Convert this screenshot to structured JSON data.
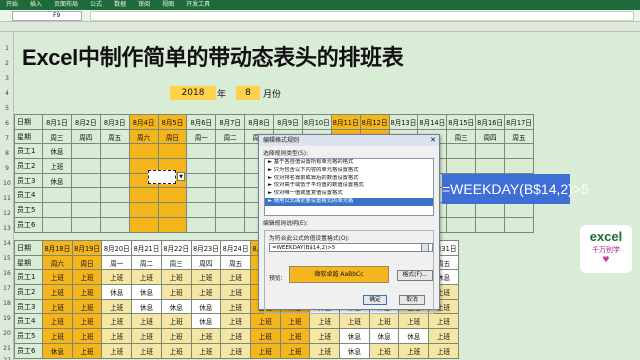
{
  "ribbon": {
    "tabs": [
      "开始",
      "插入",
      "页面布局",
      "公式",
      "数据",
      "审阅",
      "视图",
      "开发工具"
    ]
  },
  "formula_bar": {
    "name_box": "F9",
    "content": ""
  },
  "title": "Excel中制作简单的带动态表头的排班表",
  "year": "2018",
  "year_label": "年",
  "month": "8",
  "month_label": "月份",
  "rows_left": [
    "1",
    "2",
    "3",
    "4",
    "5",
    "6",
    "7",
    "8",
    "9",
    "10",
    "11",
    "12",
    "13",
    "14",
    "15",
    "16",
    "17",
    "18",
    "19",
    "20",
    "21",
    "22"
  ],
  "table1": {
    "date_label": "日期",
    "week_label": "星期",
    "dates": [
      "8月1日",
      "8月2日",
      "8月3日",
      "8月4日",
      "8月5日",
      "8月6日",
      "8月7日",
      "8月8日",
      "8月9日",
      "8月10日",
      "8月11日",
      "8月12日",
      "8月13日",
      "8月14日",
      "8月15日",
      "8月16日",
      "8月17日"
    ],
    "weekdays": [
      "周三",
      "周四",
      "周五",
      "周六",
      "周日",
      "周一",
      "周二",
      "周三",
      "周四",
      "周五",
      "周六",
      "周日",
      "周一",
      "周二",
      "周三",
      "周四",
      "周五"
    ],
    "staff": [
      {
        "name": "员工1",
        "c": [
          "休息",
          "",
          "",
          "",
          "",
          "",
          "",
          "",
          "",
          "",
          "",
          "",
          "",
          "",
          "",
          "",
          ""
        ]
      },
      {
        "name": "员工2",
        "c": [
          "上班",
          "",
          "",
          "",
          "",
          "",
          "",
          "",
          "",
          "",
          "",
          "",
          "",
          "",
          "",
          "",
          ""
        ]
      },
      {
        "name": "员工3",
        "c": [
          "休息",
          "",
          "",
          "",
          "",
          "",
          "",
          "",
          "",
          "",
          "",
          "",
          "",
          "",
          "",
          "",
          ""
        ]
      },
      {
        "name": "员工4",
        "c": [
          "",
          "",
          "",
          "",
          "",
          "",
          "",
          "",
          "",
          "",
          "",
          "",
          "",
          "",
          "",
          "",
          ""
        ]
      },
      {
        "name": "员工5",
        "c": [
          "",
          "",
          "",
          "",
          "",
          "",
          "",
          "",
          "",
          "",
          "",
          "",
          "",
          "",
          "",
          "",
          ""
        ]
      },
      {
        "name": "员工6",
        "c": [
          "",
          "",
          "",
          "",
          "",
          "",
          "",
          "",
          "",
          "",
          "",
          "",
          "",
          "",
          "",
          "",
          ""
        ]
      }
    ]
  },
  "table2": {
    "date_label": "日期",
    "week_label": "星期",
    "dates": [
      "8月18日",
      "8月19日",
      "8月20日",
      "8月21日",
      "8月22日",
      "8月23日",
      "8月24日",
      "8月25日",
      "8月26日",
      "8月27日",
      "8月28日",
      "8月29日",
      "8月30日",
      "8月31日"
    ],
    "weekdays": [
      "周六",
      "周日",
      "周一",
      "周二",
      "周三",
      "周四",
      "周五",
      "周六",
      "周日",
      "周一",
      "周二",
      "周三",
      "周四",
      "周五"
    ],
    "staff": [
      {
        "name": "员工1",
        "c": [
          "上班",
          "上班",
          "上班",
          "上班",
          "上班",
          "上班",
          "上班",
          "上班",
          "上班",
          "上班",
          "休息",
          "休息",
          "休息",
          "休息"
        ]
      },
      {
        "name": "员工2",
        "c": [
          "上班",
          "上班",
          "休息",
          "休息",
          "上班",
          "上班",
          "上班",
          "上班",
          "上班",
          "上班",
          "上班",
          "上班",
          "上班",
          "上班"
        ]
      },
      {
        "name": "员工3",
        "c": [
          "上班",
          "上班",
          "上班",
          "休息",
          "休息",
          "休息",
          "上班",
          "上班",
          "休息",
          "休息",
          "休息",
          "休息",
          "上班",
          "上班"
        ]
      },
      {
        "name": "员工4",
        "c": [
          "上班",
          "上班",
          "上班",
          "上班",
          "上班",
          "休息",
          "上班",
          "上班",
          "上班",
          "上班",
          "上班",
          "上班",
          "上班",
          "上班"
        ]
      },
      {
        "name": "员工5",
        "c": [
          "上班",
          "上班",
          "上班",
          "上班",
          "上班",
          "上班",
          "上班",
          "上班",
          "上班",
          "上班",
          "休息",
          "休息",
          "休息",
          "上班"
        ]
      },
      {
        "name": "员工6",
        "c": [
          "休息",
          "上班",
          "上班",
          "上班",
          "上班",
          "上班",
          "上班",
          "上班",
          "上班",
          "上班",
          "休息",
          "上班",
          "上班",
          "上班"
        ]
      }
    ]
  },
  "dialog": {
    "title": "编辑格式规则",
    "close": "✕",
    "rule_type_label": "选择规则类型(S):",
    "rules": [
      "► 基于各自值设置所有单元格的格式",
      "► 只为包含以下内容的单元格设置格式",
      "► 仅对排名靠前或靠后的数值设置格式",
      "► 仅对高于或低于平均值的数值设置格式",
      "► 仅对唯一值或重复值设置格式",
      "► 使用公式确定要设置格式的单元格"
    ],
    "edit_label": "编辑规则说明(E):",
    "formula_label": "为符合此公式的值设置格式(O):",
    "formula": "=WEEKDAY(B$14,2)>5",
    "preview_label": "预览:",
    "preview_text": "微软卓越  AaBbCc",
    "format_button": "格式(F)...",
    "ok_button": "确定",
    "cancel_button": "取消"
  },
  "callout": "=WEEKDAY(B$14,2)>5",
  "logo": {
    "line1": "excel",
    "line2": "千万别学"
  },
  "colors": {
    "weekend": "#f5b51c",
    "accent": "#3f6fd6",
    "sheet_bg": "#d9ecd6"
  }
}
